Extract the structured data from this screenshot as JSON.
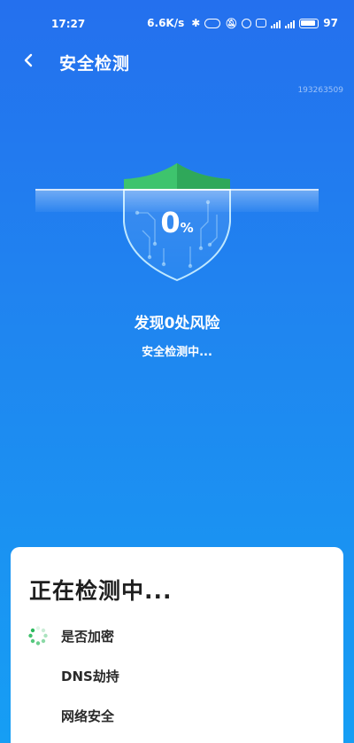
{
  "status_bar": {
    "time": "17:27",
    "speed": "6.6K/s",
    "battery": "97"
  },
  "header": {
    "title": "安全检测",
    "device_id": "193263509"
  },
  "scan": {
    "percent": "0",
    "percent_unit": "%",
    "risk_text": "发现0处风险",
    "status_text": "安全检测中..."
  },
  "panel": {
    "title": "正在检测中...",
    "items": [
      {
        "label": "是否加密",
        "state": "loading"
      },
      {
        "label": "DNS劫持",
        "state": "pending"
      },
      {
        "label": "网络安全",
        "state": "pending"
      }
    ]
  },
  "colors": {
    "background_top": "#2470ee",
    "background_bottom": "#169ef4",
    "shield_green": "#3ec46d",
    "spinner_green": "#2bb95c"
  }
}
